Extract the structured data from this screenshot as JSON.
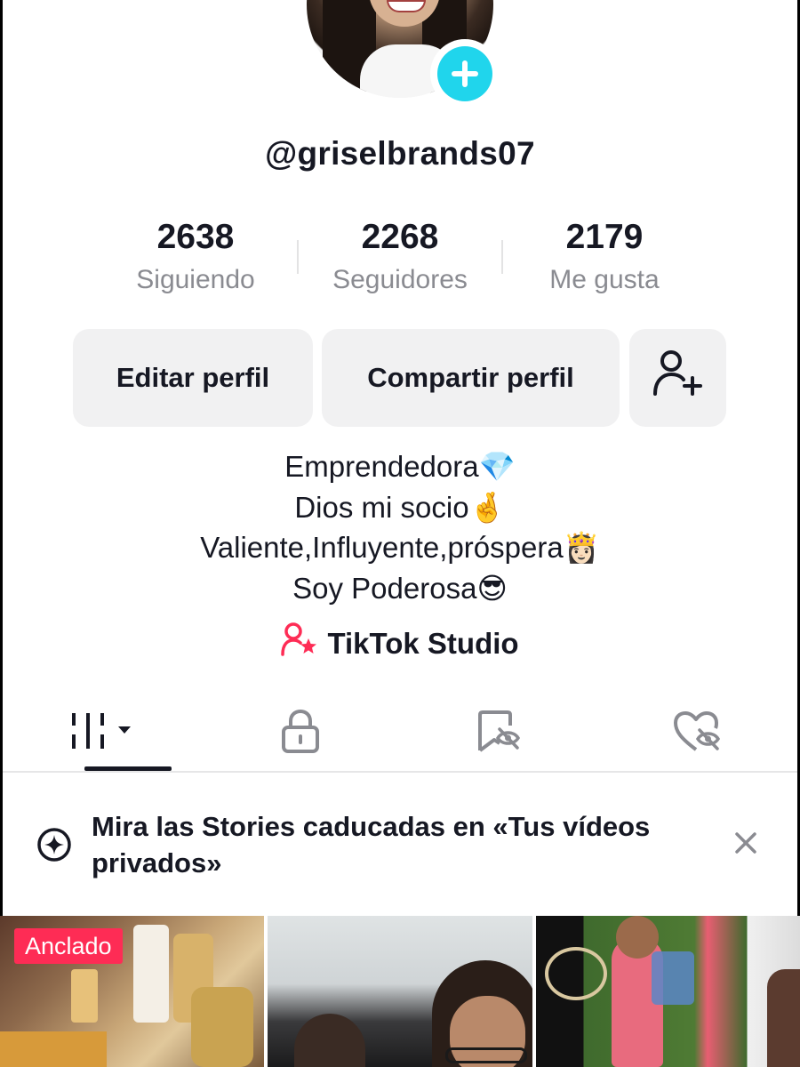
{
  "profile": {
    "username": "@griselbrands07"
  },
  "stats": [
    {
      "value": "2638",
      "label": "Siguiendo"
    },
    {
      "value": "2268",
      "label": "Seguidores"
    },
    {
      "value": "2179",
      "label": "Me gusta"
    }
  ],
  "buttons": {
    "edit": "Editar perfil",
    "share": "Compartir perfil"
  },
  "bio": [
    "Emprendedora💎",
    "Dios mi socio🤞",
    "Valiente,Influyente,próspera👸🏻",
    "Soy Poderosa😎"
  ],
  "studio": {
    "label": "TikTok Studio"
  },
  "banner": {
    "text": "Mira las Stories caducadas en «Tus vídeos privados»"
  },
  "videos": [
    {
      "badge": "Anclado"
    },
    {},
    {}
  ],
  "colors": {
    "accent": "#20d5ec",
    "pinned": "#fe2c55",
    "studio_icon": "#fe2c55",
    "button_bg": "#f1f1f2"
  },
  "icons": {
    "avatar_add": "plus-icon",
    "add_friend": "person-add-icon",
    "studio": "person-star-icon",
    "tab_videos": "grid-columns-icon",
    "tab_private": "lock-icon",
    "tab_favorites": "bookmark-hidden-icon",
    "tab_liked": "heart-hidden-icon",
    "banner": "story-sparkle-icon",
    "banner_close": "close-icon"
  }
}
